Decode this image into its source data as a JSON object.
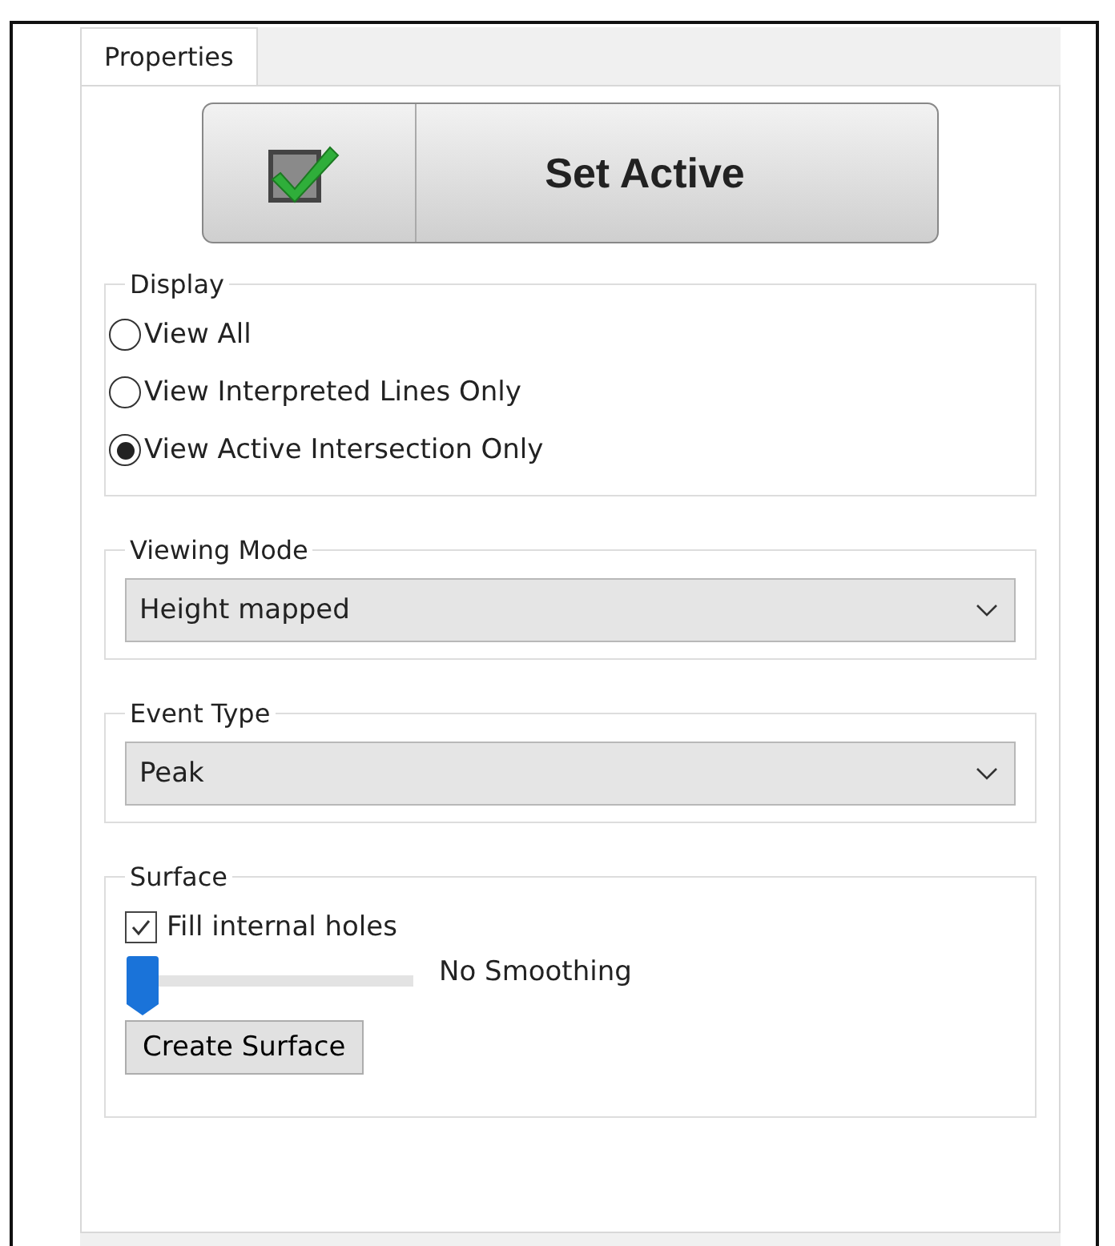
{
  "tabs": [
    {
      "label": "Properties",
      "selected": true
    }
  ],
  "set_active_button": {
    "label": "Set Active"
  },
  "display": {
    "title": "Display",
    "options": [
      {
        "label": "View All",
        "selected": false
      },
      {
        "label": "View Interpreted Lines Only",
        "selected": false
      },
      {
        "label": "View Active Intersection Only",
        "selected": true
      }
    ]
  },
  "viewing_mode": {
    "title": "Viewing Mode",
    "value": "Height mapped"
  },
  "event_type": {
    "title": "Event Type",
    "value": "Peak"
  },
  "surface": {
    "title": "Surface",
    "fill_internal_holes": {
      "label": "Fill internal holes",
      "checked": true
    },
    "smoothing": {
      "level": 0,
      "reading": "No Smoothing"
    },
    "button": "Create Surface"
  }
}
